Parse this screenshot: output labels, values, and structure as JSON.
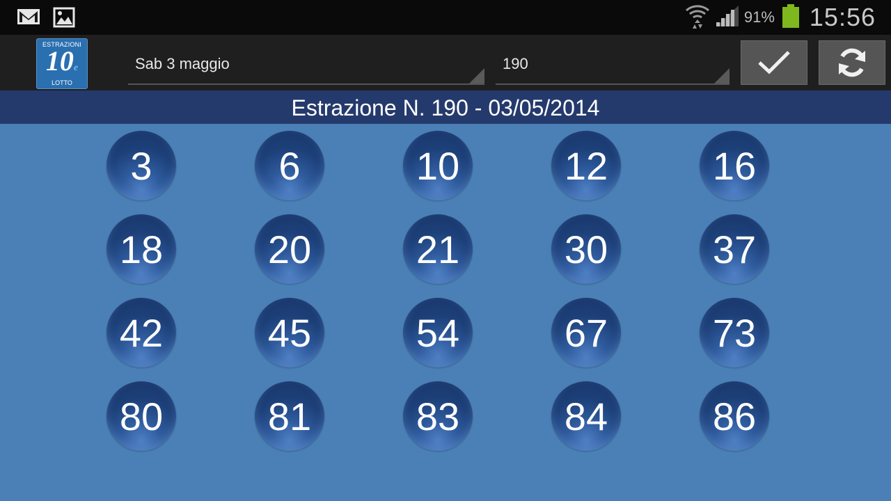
{
  "status_bar": {
    "notification_icons": [
      "gmail-icon",
      "image-icon"
    ],
    "battery_percent": "91%",
    "battery_level": 0.91,
    "time": "15:56"
  },
  "action_bar": {
    "logo": {
      "top_text": "ESTRAZIONI",
      "main_text": "10",
      "suffix": "e",
      "bottom_text": "LOTTO"
    },
    "date_spinner": {
      "value": "Sab 3 maggio"
    },
    "number_spinner": {
      "value": "190"
    },
    "buttons": [
      {
        "icon": "checkmark-icon"
      },
      {
        "icon": "refresh-icon"
      }
    ]
  },
  "header": {
    "title": "Estrazione N. 190 - 03/05/2014"
  },
  "numbers": [
    3,
    6,
    10,
    12,
    16,
    18,
    20,
    21,
    30,
    37,
    42,
    45,
    54,
    67,
    73,
    80,
    81,
    83,
    84,
    86
  ],
  "colors": {
    "header_bg": "#253a6c",
    "content_bg": "#4a80b5",
    "ball": "#1d4079",
    "battery": "#7fb81e"
  }
}
